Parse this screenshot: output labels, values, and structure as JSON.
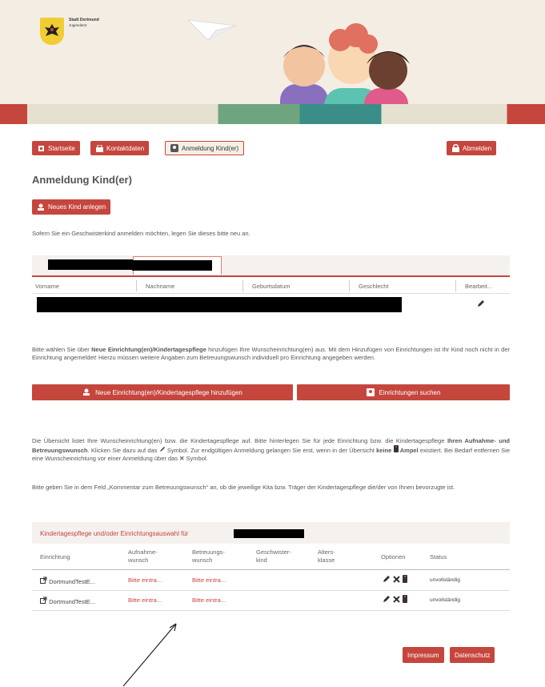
{
  "header": {
    "logo_line1": "Stadt Dortmund",
    "logo_line2": "Jugendamt",
    "colors": {
      "bg": "#f4ede4",
      "accent": "#c5463d"
    }
  },
  "nav": {
    "startseite": "Startseite",
    "kontaktdaten": "Kontaktdaten",
    "anmeldung": "Anmeldung Kind(er)",
    "abmelden": "Abmelden"
  },
  "page_title": "Anmeldung Kind(er)",
  "new_child_button": "Neues Kind anlegen",
  "sibling_hint": "Sofern Sie ein Geschwisterkind anmelden möchten, legen Sie dieses bitte neu an.",
  "children_table": {
    "headers": [
      "Vorname",
      "Nachname",
      "Geburtsdatum",
      "Geschlecht",
      "Bearbeit..."
    ]
  },
  "info1": {
    "part1": "Bitte wählen Sie über ",
    "bold": "Neue Einrichtung(en)/Kindertagespflege",
    "part2": " hinzufügen Ihre Wunscheinrichtung(en) aus. Mit dem Hinzufügen von Einrichtungen ist Ihr Kind noch nicht in der Einrichtung angemeldet! Hierzu müssen weitere Angaben zum Betreuungswunsch individuell pro Einrichtung angegeben werden."
  },
  "actions": {
    "add_facility": "Neue Einrichtung(en)/Kindertagespflege hinzufügen",
    "search_facility": "Einrichtungen suchen"
  },
  "info2": {
    "p1": "Die Übersicht listet Ihre Wunscheinrichtung(en) bzw. die Kindertagespflege auf. Bitte hinterlegen Sie für jede Einrichtung bzw. die Kindertagespflege ",
    "b1": "Ihren Aufnahme- und Betreuungswunsch",
    "p2": ". Klicken Sie dazu auf das ",
    "p3": " Symbol. Zur endgültigen Anmeldung gelangen Sie erst, wenn in der Übersicht ",
    "b2": "keine",
    "b3": "Ampel",
    "p4": " existiert. Bei Bedarf entfernen Sie eine Wunscheinrichtung vor einer Anmeldung über das ",
    "p5": " Symbol."
  },
  "info3": "Bitte geben Sie in dem Feld „Kommentar zum Betreuungswunsch“ an, ob die jeweilige Kita bzw. Träger der Kindertagespflege die/der von Ihnen bevorzugte ist.",
  "selection": {
    "title": "Kindertagespflege und/oder Einrichtungsauswahl für",
    "headers": {
      "einrichtung": "Einrichtung",
      "aufnahme_1": "Aufnahme-",
      "aufnahme_2": "wunsch",
      "betreuung_1": "Betreuungs-",
      "betreuung_2": "wunsch",
      "geschwister_1": "Geschwister-",
      "geschwister_2": "kind",
      "alters_1": "Alters-",
      "alters_2": "klasse",
      "optionen": "Optionen",
      "status": "Status"
    },
    "rows": [
      {
        "name": "DortmundTestE...",
        "aufnahme": "Bitte eintra...",
        "betreuung": "Bitte eintra...",
        "status": "unvollständig"
      },
      {
        "name": "DortmundTestE...",
        "aufnahme": "Bitte eintra...",
        "betreuung": "Bitte eintra...",
        "status": "unvollständig"
      }
    ]
  },
  "footer": {
    "impressum": "Impressum",
    "datenschutz": "Datenschutz"
  }
}
